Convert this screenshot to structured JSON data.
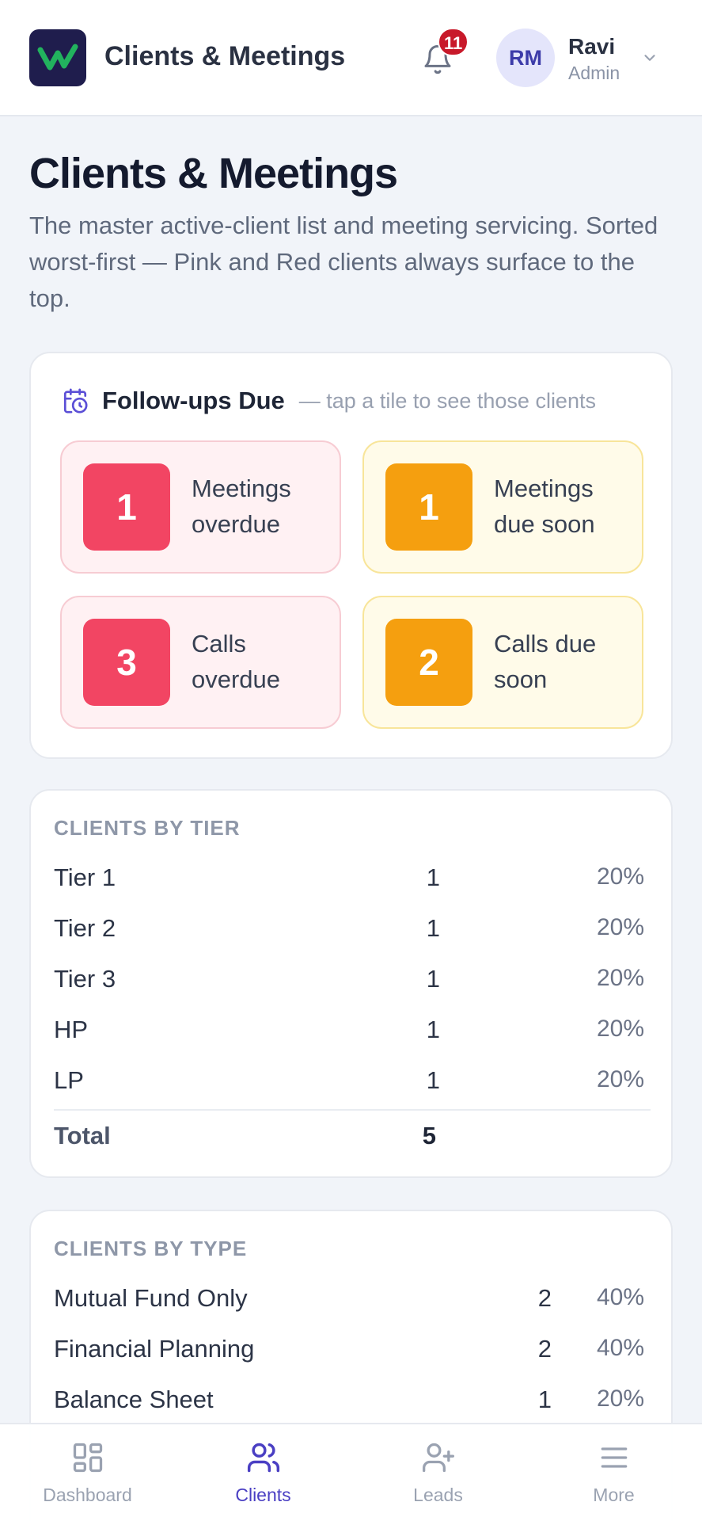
{
  "header": {
    "app_title": "Clients & Meetings",
    "notification_count": "11",
    "avatar_initials": "RM",
    "user_name": "Ravi",
    "user_role": "Admin"
  },
  "page": {
    "title": "Clients & Meetings",
    "subtitle": "The master active-client list and meeting servicing. Sorted worst-first — Pink and Red clients always surface to the top."
  },
  "followups": {
    "title": "Follow-ups Due",
    "hint": "— tap a tile to see those clients",
    "tiles": [
      {
        "count": "1",
        "label": "Meetings overdue",
        "status": "overdue"
      },
      {
        "count": "1",
        "label": "Meetings due soon",
        "status": "due-soon"
      },
      {
        "count": "3",
        "label": "Calls overdue",
        "status": "overdue"
      },
      {
        "count": "2",
        "label": "Calls due soon",
        "status": "due-soon"
      }
    ]
  },
  "clients_by_tier": {
    "label": "CLIENTS BY TIER",
    "rows": [
      {
        "name": "Tier 1",
        "count": "1",
        "pct": "20%"
      },
      {
        "name": "Tier 2",
        "count": "1",
        "pct": "20%"
      },
      {
        "name": "Tier 3",
        "count": "1",
        "pct": "20%"
      },
      {
        "name": "HP",
        "count": "1",
        "pct": "20%"
      },
      {
        "name": "LP",
        "count": "1",
        "pct": "20%"
      }
    ],
    "total_label": "Total",
    "total_count": "5"
  },
  "clients_by_type": {
    "label": "CLIENTS BY TYPE",
    "rows": [
      {
        "name": "Mutual Fund Only",
        "count": "2",
        "pct": "40%"
      },
      {
        "name": "Financial Planning",
        "count": "2",
        "pct": "40%"
      },
      {
        "name": "Balance Sheet",
        "count": "1",
        "pct": "20%"
      }
    ]
  },
  "bottom_nav": [
    {
      "label": "Dashboard",
      "icon": "dashboard-icon",
      "active": false
    },
    {
      "label": "Clients",
      "icon": "clients-icon",
      "active": true
    },
    {
      "label": "Leads",
      "icon": "add-user-icon",
      "active": false
    },
    {
      "label": "More",
      "icon": "menu-icon",
      "active": false
    }
  ],
  "colors": {
    "accent": "#4a3fc3",
    "overdue": "#f24563",
    "due_soon": "#f59f0f",
    "badge": "#c8192a",
    "logo_bg": "#1f1d4d",
    "logo_mark": "#22b35e"
  }
}
